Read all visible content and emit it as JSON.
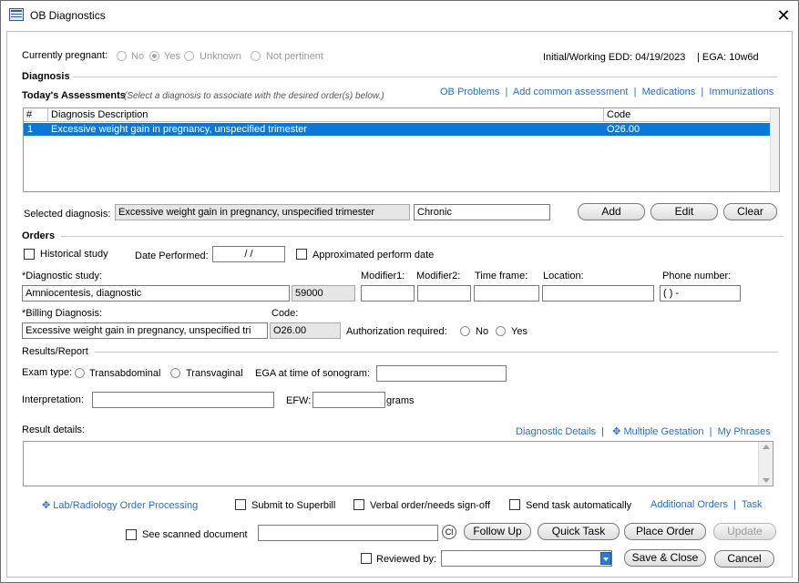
{
  "window": {
    "title": "OB Diagnostics",
    "close_glyph": "✕"
  },
  "pregnancy": {
    "label": "Currently pregnant:",
    "options": [
      "No",
      "Yes",
      "Unknown",
      "Not pertinent"
    ],
    "selected": "Yes",
    "edd": "Initial/Working EDD: 04/19/2023",
    "ega": "| EGA: 10w6d"
  },
  "diagnosis": {
    "section_title": "Diagnosis",
    "assessments_title": "Today's Assessments",
    "assessments_hint": "(Select a diagnosis to associate with the desired order(s) below.)",
    "links": [
      "OB Problems",
      "Add common assessment",
      "Medications",
      "Immunizations"
    ],
    "table": {
      "columns": [
        "#",
        "Diagnosis Description",
        "Code"
      ],
      "rows": [
        {
          "num": "1",
          "description": "Excessive weight gain in pregnancy, unspecified trimester",
          "code": "O26.00"
        }
      ]
    },
    "selected_label": "Selected diagnosis:",
    "selected_value": "Excessive weight gain in pregnancy, unspecified trimester",
    "chronic_value": "Chronic",
    "buttons": {
      "add": "Add",
      "edit": "Edit",
      "clear": "Clear"
    }
  },
  "orders": {
    "section_title": "Orders",
    "historical_study": "Historical study",
    "date_performed_label": "Date Performed:",
    "date_performed_value": "/ /",
    "approx_date": "Approximated perform date",
    "diagnostic_study_label": "*Diagnostic study:",
    "diagnostic_study_value": "Amniocentesis, diagnostic",
    "cpt_code": "59000",
    "modifier1_label": "Modifier1:",
    "modifier2_label": "Modifier2:",
    "time_frame_label": "Time frame:",
    "location_label": "Location:",
    "phone_label": "Phone number:",
    "phone_value": "(   )   -",
    "billing_label": "*Billing Diagnosis:",
    "billing_value": "Excessive weight gain in pregnancy, unspecified tri",
    "code_label": "Code:",
    "code_value": "O26.00",
    "auth_label": "Authorization required:",
    "auth_options": [
      "No",
      "Yes"
    ]
  },
  "results": {
    "section_title": "Results/Report",
    "exam_type_label": "Exam type:",
    "exam_options": [
      "Transabdominal",
      "Transvaginal"
    ],
    "ega_label": "EGA at time of sonogram:",
    "interpretation_label": "Interpretation:",
    "efw_label": "EFW:",
    "grams_label": "grams",
    "result_details_label": "Result details:",
    "links": [
      "Diagnostic Details",
      "Multiple Gestation",
      "My Phrases"
    ]
  },
  "footer": {
    "lab_link": "Lab/Radiology Order Processing",
    "submit_superbill": "Submit to Superbill",
    "verbal_order": "Verbal order/needs sign-off",
    "send_task": "Send task automatically",
    "additional_orders": "Additional Orders",
    "task_link": "Task",
    "see_scanned": "See scanned document",
    "cl_glyph": "Cl",
    "buttons": {
      "follow_up": "Follow Up",
      "quick_task": "Quick Task",
      "place_order": "Place Order",
      "update": "Update",
      "save_close": "Save & Close",
      "cancel": "Cancel"
    },
    "reviewed_by": "Reviewed by:"
  }
}
